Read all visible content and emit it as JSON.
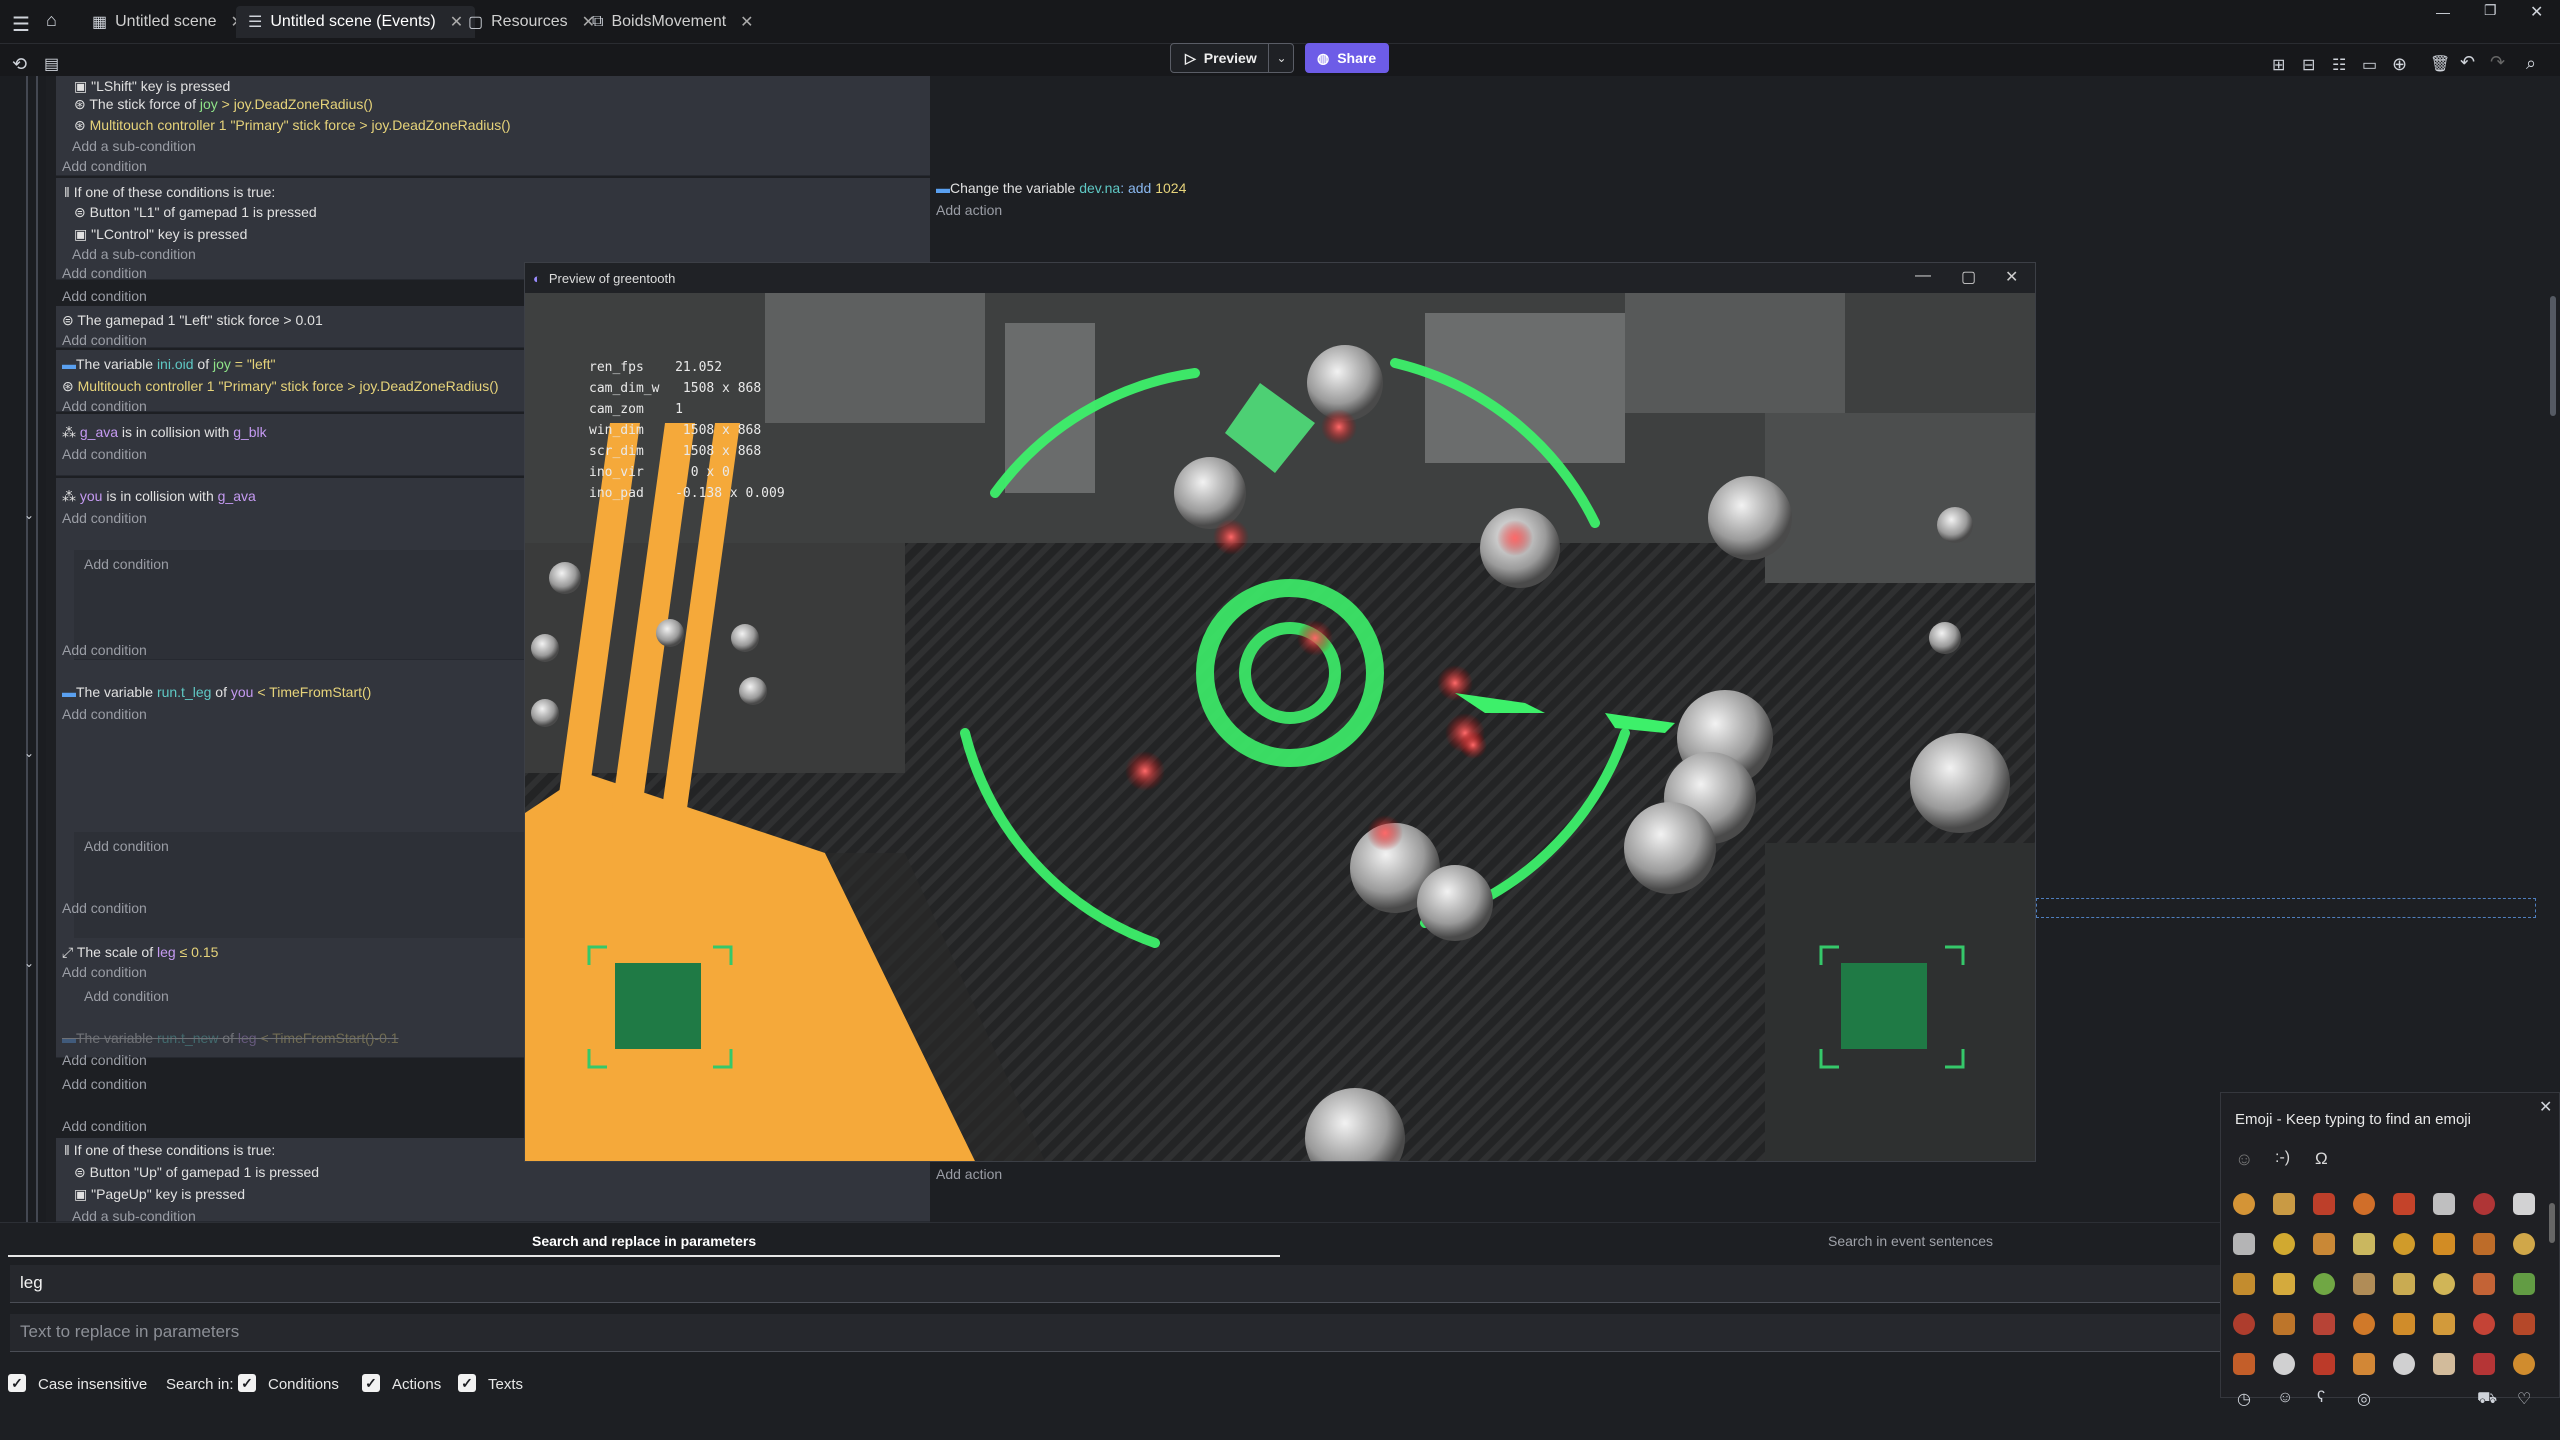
{
  "tabs": [
    {
      "label": "Untitled scene",
      "icon": "scene-icon"
    },
    {
      "label": "Untitled scene (Events)",
      "icon": "events-icon",
      "active": true
    },
    {
      "label": "Resources",
      "icon": "resources-icon"
    },
    {
      "label": "BoidsMovement",
      "icon": "extension-icon"
    }
  ],
  "toolbar": {
    "preview_label": "Preview",
    "share_label": "Share"
  },
  "events": {
    "r1_c1": "\"LShift\" key is pressed",
    "r1_c2a": "The stick force of ",
    "r1_c2b": "joy",
    "r1_c2c": " > joy.DeadZoneRadius()",
    "r1_c3": "Multitouch controller 1 \"Primary\" stick force > joy.DeadZoneRadius()",
    "add_subcondition": "Add a sub-condition",
    "add_condition": "Add condition",
    "add_action": "Add action",
    "r2_head": "If one of these conditions is true:",
    "r2_c1": "Button \"L1\" of gamepad 1 is pressed",
    "r2_c2": "\"LControl\" key is pressed",
    "r3_c1": "The gamepad 1 \"Left\" stick force > 0.01",
    "r4_c1a": "The variable ",
    "r4_c1b": "ini.oid",
    "r4_c1c": " of ",
    "r4_c1d": "joy",
    "r4_c1e": " = \"left\"",
    "r4_c2": "Multitouch controller 1 \"Primary\" stick force > joy.DeadZoneRadius()",
    "r5_c1a": "g_ava",
    "r5_c1b": " is in collision with ",
    "r5_c1c": "g_blk",
    "r6_c1a": "you",
    "r6_c1b": " is in collision with ",
    "r6_c1c": "g_ava",
    "r7_c1a": "The variable ",
    "r7_c1b": "run.t_leg",
    "r7_c1c": " of ",
    "r7_c1d": "you",
    "r7_c1e": " < TimeFromStart()",
    "r8_c1a": "The scale of ",
    "r8_c1b": "leg",
    "r8_c1c": " ≤ 0.15",
    "r9_c1a": "The variable ",
    "r9_c1b": "run.t_new",
    "r9_c1c": " of ",
    "r9_c1d": "leg",
    "r9_c1e": " < TimeFromStart()-0.1",
    "r10_head": "If one of these conditions is true:",
    "r10_c1": "Button \"Up\" of gamepad 1 is pressed",
    "r10_c2": "\"PageUp\" key is pressed",
    "act1a": "Change the variable ",
    "act1b": "dev.na",
    "act1c": ": add ",
    "act1d": "1024"
  },
  "preview": {
    "title": "Preview of greentooth",
    "hud": "ren_fps    21.052\ncam_dim_w   1508 x 868\ncam_zom    1\nwin_dim     1508 x 868\nscr_dim     1508 x 868\nino_vir      0 x 0\nino_pad    -0.138 x 0.009"
  },
  "search": {
    "tab_params": "Search and replace in parameters",
    "tab_sentences": "Search in event sentences",
    "search_value": "leg",
    "replace_placeholder": "Text to replace in parameters",
    "case_label": "Case insensitive",
    "search_in_label": "Search in:",
    "conditions_label": "Conditions",
    "actions_label": "Actions",
    "texts_label": "Texts"
  },
  "emoji": {
    "title": "Emoji - Keep typing to find an emoji",
    "tab_emoticon": ":-)",
    "tab_symbol": "Ω"
  },
  "colors": {
    "accent": "#6d5ce7",
    "green": "#2ecc40",
    "orange": "#f5a93a"
  }
}
